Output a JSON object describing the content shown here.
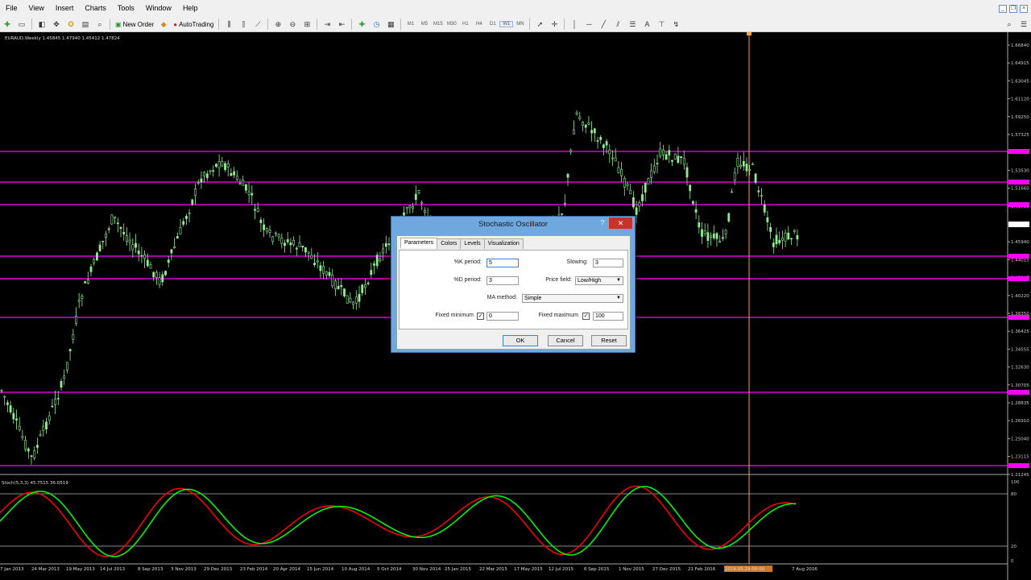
{
  "menubar": {
    "items": [
      "File",
      "View",
      "Insert",
      "Charts",
      "Tools",
      "Window",
      "Help"
    ]
  },
  "toolbar": {
    "new_order": "New Order",
    "autotrading": "AutoTrading",
    "timeframes": [
      "M1",
      "M5",
      "M15",
      "M30",
      "H1",
      "H4",
      "D1",
      "W1",
      "MN"
    ],
    "active_timeframe": "W1"
  },
  "chart": {
    "symbol_header": "EURAUD,Weekly  1.45845 1.47940 1.45412 1.47824",
    "indicator_header": "Stoch(5,3,3) 45.7515 36.0519",
    "price_labels": [
      "1.66840",
      "1.64915",
      "1.63045",
      "1.61120",
      "1.59250",
      "1.57325",
      "1.55455",
      "1.53530",
      "1.51660",
      "1.49735",
      "1.47824",
      "1.45940",
      "1.44015",
      "1.42145",
      "1.40220",
      "1.38350",
      "1.36425",
      "1.34555",
      "1.32630",
      "1.30705",
      "1.28835",
      "1.26910",
      "1.25040",
      "1.23115",
      "1.21245"
    ],
    "date_labels": [
      "7 Jan 2013",
      "24 Mar 2013",
      "19 May 2013",
      "14 Jul 2013",
      "8 Sep 2013",
      "3 Nov 2013",
      "29 Dec 2013",
      "23 Feb 2014",
      "20 Apr 2014",
      "15 Jun 2014",
      "10 Aug 2014",
      "5 Oct 2014",
      "30 Nov 2014",
      "25 Jan 2015",
      "22 Mar 2015",
      "17 May 2015",
      "12 Jul 2015",
      "6 Sep 2015",
      "1 Nov 2015",
      "27 Dec 2015",
      "21 Feb 2016",
      "2016.05.29 00:00",
      "7 Aug 2016"
    ],
    "osc_levels": [
      "100",
      "80",
      "20",
      "0"
    ],
    "colors": {
      "bull": "#90ee90",
      "level_line": "#ff00ff",
      "k_line": "#00ff00",
      "d_line": "#ff0000",
      "crosshair": "#ffa040"
    }
  },
  "dialog": {
    "title": "Stochastic Oscillator",
    "help": "?",
    "close": "✕",
    "tabs": [
      "Parameters",
      "Colors",
      "Levels",
      "Visualization"
    ],
    "active_tab": "Parameters",
    "k_period_label": "%K period:",
    "k_period": "5",
    "d_period_label": "%D period:",
    "d_period": "3",
    "slowing_label": "Slowing:",
    "slowing": "3",
    "price_field_label": "Price field:",
    "price_field": "Low/High",
    "ma_method_label": "MA method:",
    "ma_method": "Simple",
    "fixed_min_label": "Fixed minimum",
    "fixed_min": "0",
    "fixed_max_label": "Fixed maximum",
    "fixed_max": "100",
    "ok": "OK",
    "cancel": "Cancel",
    "reset": "Reset"
  }
}
